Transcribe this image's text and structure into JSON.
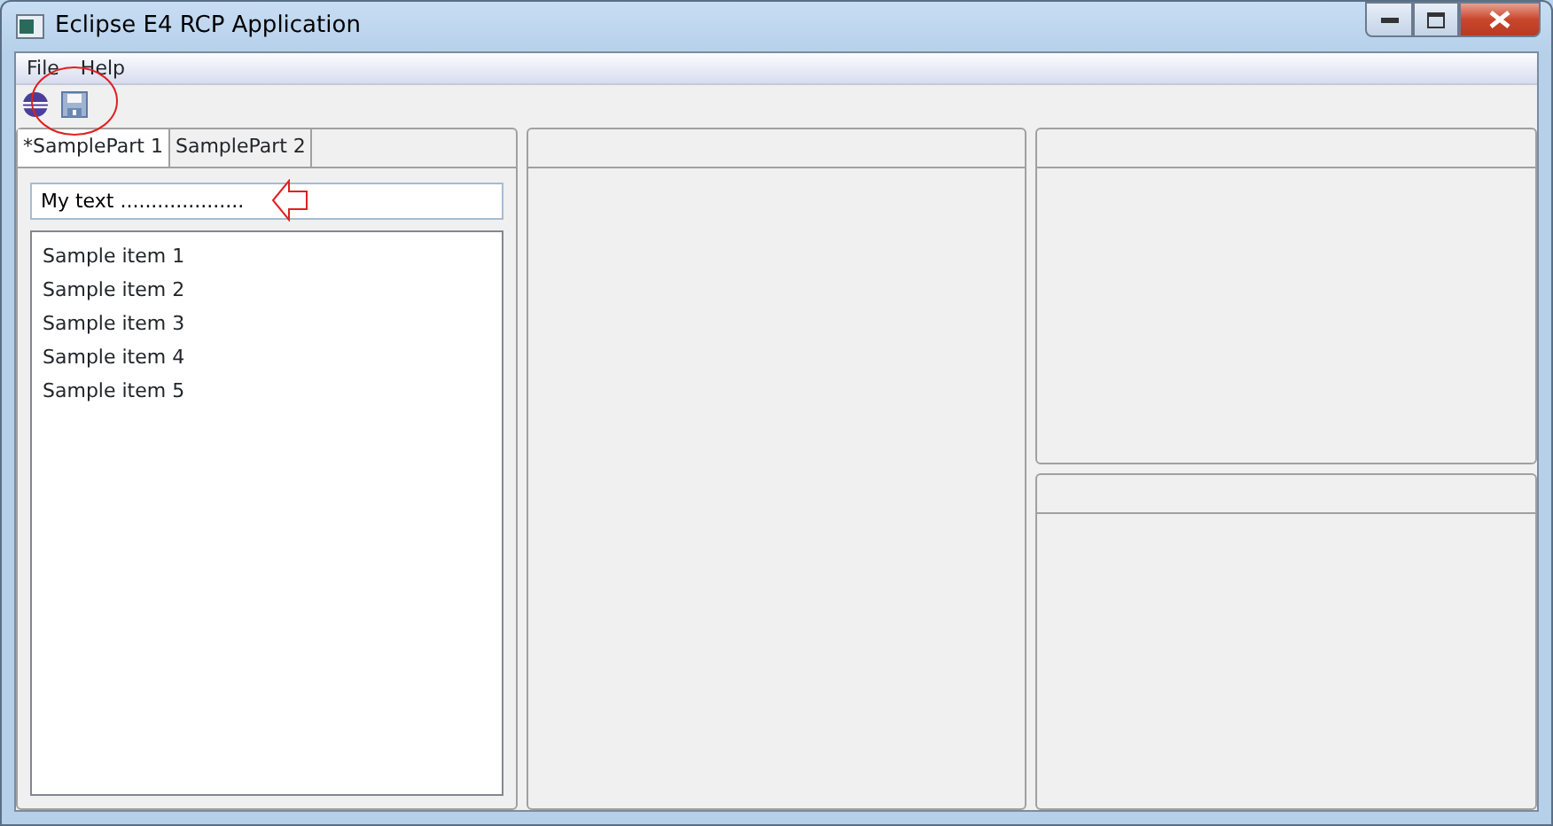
{
  "window": {
    "title": "Eclipse E4 RCP Application"
  },
  "menu": [
    "File",
    "Help"
  ],
  "toolbar": [
    {
      "kind": "eclipse"
    },
    {
      "kind": "save",
      "highlighted": true
    }
  ],
  "left_part": {
    "tabs": [
      {
        "label": "*SamplePart 1",
        "selected": true
      },
      {
        "label": "SamplePart 2",
        "selected": false
      }
    ],
    "text_field": {
      "value": "My text ....................",
      "highlighted": true
    },
    "list": [
      "Sample item 1",
      "Sample item 2",
      "Sample item 3",
      "Sample item 4",
      "Sample item 5"
    ]
  }
}
